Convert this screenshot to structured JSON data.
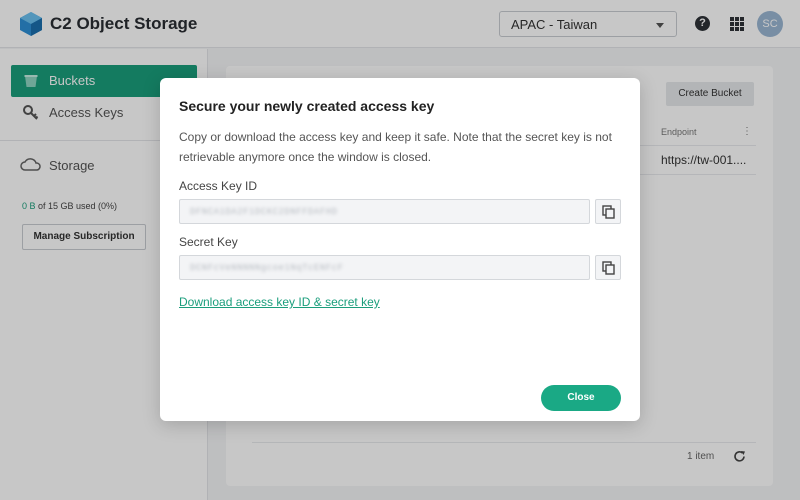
{
  "app": {
    "title": "C2 Object Storage"
  },
  "header": {
    "region": "APAC - Taiwan",
    "help_glyph": "?",
    "avatar_initials": "SC"
  },
  "sidebar": {
    "items": [
      {
        "label": "Buckets",
        "icon": "bucket-icon",
        "active": true
      },
      {
        "label": "Access Keys",
        "icon": "key-icon",
        "active": false
      }
    ],
    "storage_label": "Storage",
    "usage_used": "0 B",
    "usage_rest": " of 15 GB used (0%)",
    "manage_label": "Manage Subscription"
  },
  "main": {
    "create_bucket_label": "Create Bucket",
    "column_endpoint": "Endpoint",
    "column_menu": "⋮",
    "row_endpoint": "https://tw-001....",
    "item_count": "1 item"
  },
  "modal": {
    "title": "Secure your newly created access key",
    "description": "Copy or download the access key and keep it safe. Note that the secret key is not retrievable anymore once the window is closed.",
    "access_key_label": "Access Key ID",
    "access_key_value": "DFNCA1DA2F1DCKC2DNFFDAFHD",
    "secret_key_label": "Secret Key",
    "secret_key_value": "DCNFcVeNNNNNgcoe1NqTcENFcF",
    "download_link": "Download access key ID & secret key",
    "close_label": "Close"
  },
  "colors": {
    "accent": "#1a9e7c",
    "close_button": "#1aa985"
  }
}
